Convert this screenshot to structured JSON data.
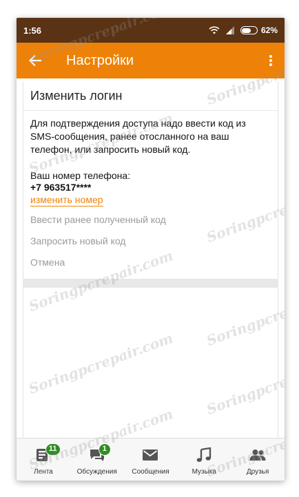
{
  "status_bar": {
    "time": "1:56",
    "battery_level": "62%",
    "battery_fraction": 0.62
  },
  "app_bar": {
    "title": "Настройки",
    "back_icon": "arrow-left-icon",
    "overflow_icon": "more-vert-icon"
  },
  "card": {
    "title": "Изменить логин",
    "description": "Для подтверждения доступа надо ввести код из SMS-сообщения, ранее отосланного на ваш телефон, или запросить новый код.",
    "phone_label": "Ваш номер телефона:",
    "phone_number": "+7 963517****",
    "change_number_link": "изменить номер",
    "actions": {
      "enter_code": "Ввести ранее полученный код",
      "request_code": "Запросить новый код",
      "cancel": "Отмена"
    }
  },
  "bottom_nav": {
    "items": [
      {
        "label": "Лента",
        "icon": "feed-icon",
        "badge": "11"
      },
      {
        "label": "Обсуждения",
        "icon": "discussions-icon",
        "badge": "1"
      },
      {
        "label": "Сообщения",
        "icon": "mail-icon"
      },
      {
        "label": "Музыка",
        "icon": "music-note-icon"
      },
      {
        "label": "Друзья",
        "icon": "friends-icon"
      }
    ]
  },
  "watermark": "Soringpcrepair.com",
  "colors": {
    "accent": "#ee8208",
    "status_bar": "#5a3214",
    "badge": "#2f8d24",
    "muted_text": "#9a9a9a"
  }
}
